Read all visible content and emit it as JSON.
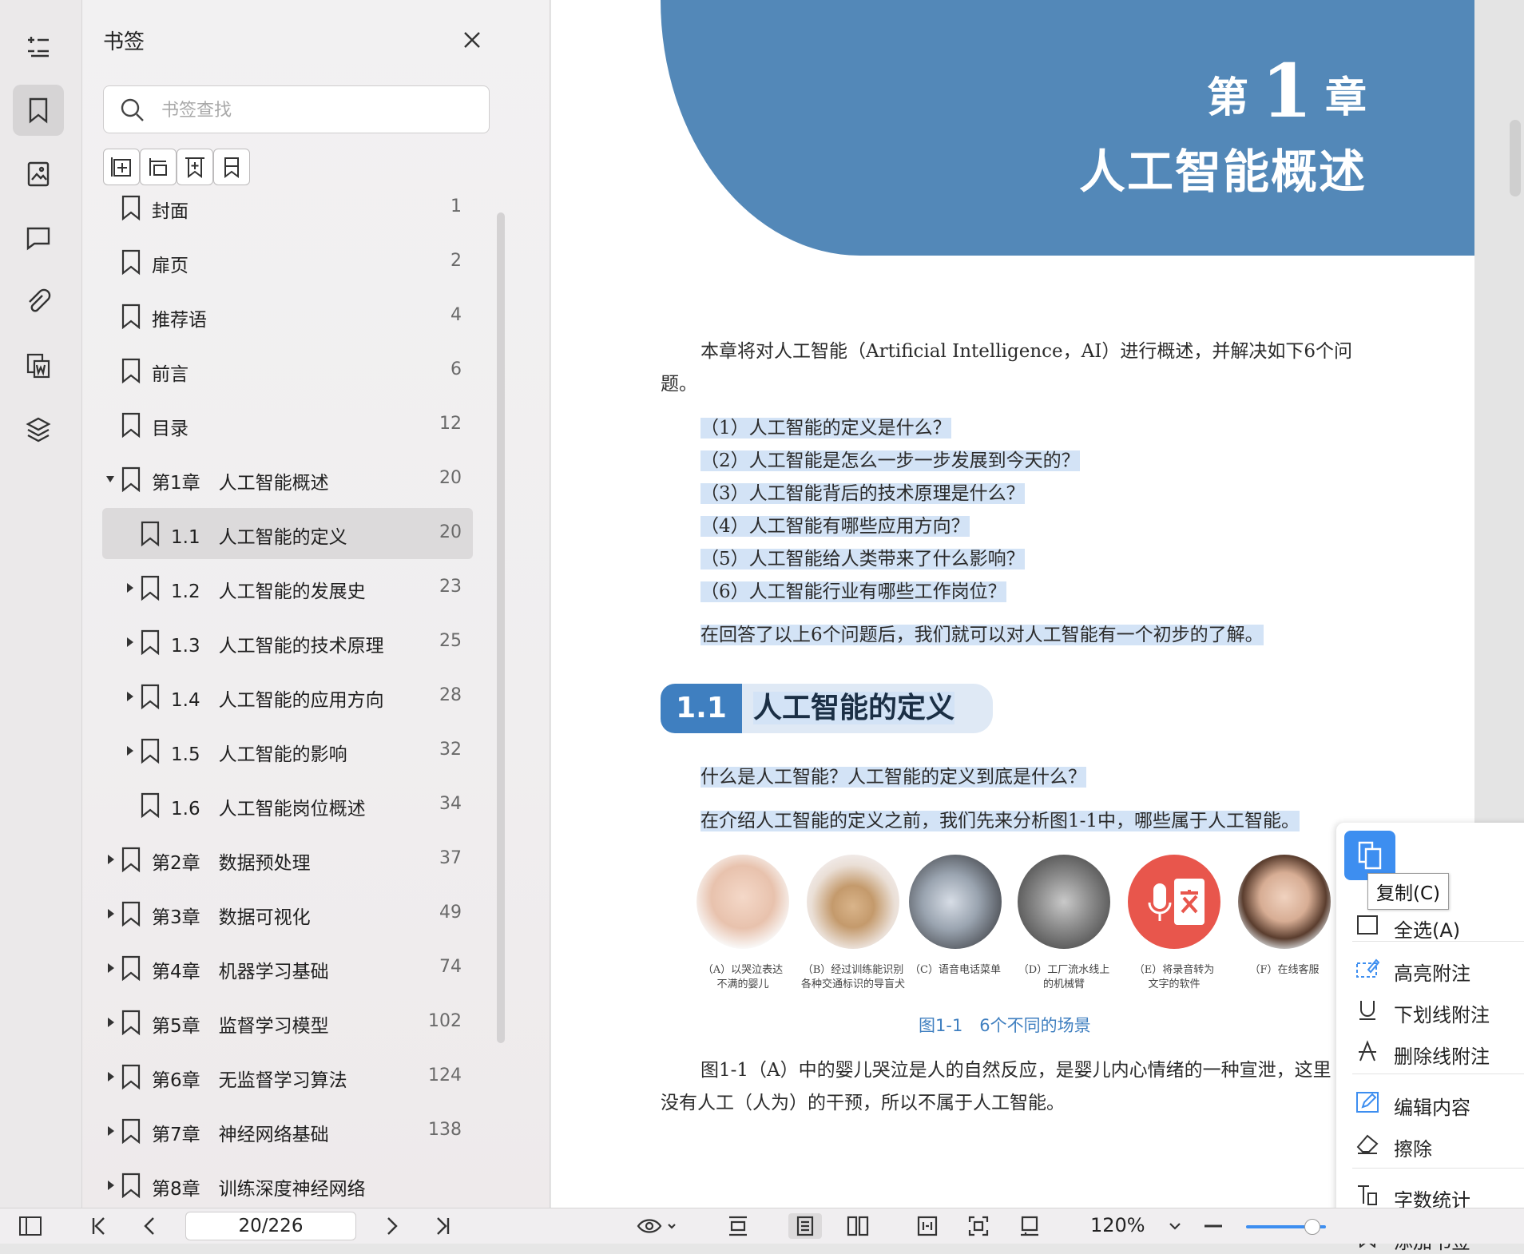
{
  "rail": {
    "items": [
      {
        "name": "outline-icon"
      },
      {
        "name": "bookmark-icon"
      },
      {
        "name": "thumbnail-icon"
      },
      {
        "name": "comment-icon"
      },
      {
        "name": "attachment-icon"
      },
      {
        "name": "word-convert-icon"
      },
      {
        "name": "layers-icon"
      }
    ]
  },
  "panel": {
    "title": "书签",
    "search_placeholder": "书签查找",
    "tools": [
      "add-bookmark-icon",
      "add-child-bookmark-icon",
      "insert-bookmark-icon",
      "bookmark-toggle-icon"
    ],
    "bookmarks": [
      {
        "label": "封面",
        "page": "1",
        "level": 0,
        "caret": false
      },
      {
        "label": "扉页",
        "page": "2",
        "level": 0,
        "caret": false
      },
      {
        "label": "推荐语",
        "page": "4",
        "level": 0,
        "caret": false
      },
      {
        "label": "前言",
        "page": "6",
        "level": 0,
        "caret": false
      },
      {
        "label": "目录",
        "page": "12",
        "level": 0,
        "caret": false
      },
      {
        "label": "第1章　人工智能概述",
        "page": "20",
        "level": 0,
        "caret": "down"
      },
      {
        "label": "1.1　人工智能的定义",
        "page": "20",
        "level": 1,
        "caret": false,
        "selected": true
      },
      {
        "label": "1.2　人工智能的发展史",
        "page": "23",
        "level": 1,
        "caret": "right"
      },
      {
        "label": "1.3　人工智能的技术原理",
        "page": "25",
        "level": 1,
        "caret": "right"
      },
      {
        "label": "1.4　人工智能的应用方向",
        "page": "28",
        "level": 1,
        "caret": "right"
      },
      {
        "label": "1.5　人工智能的影响",
        "page": "32",
        "level": 1,
        "caret": "right"
      },
      {
        "label": "1.6　人工智能岗位概述",
        "page": "34",
        "level": 1,
        "caret": false
      },
      {
        "label": "第2章　数据预处理",
        "page": "37",
        "level": 0,
        "caret": "right"
      },
      {
        "label": "第3章　数据可视化",
        "page": "49",
        "level": 0,
        "caret": "right"
      },
      {
        "label": "第4章　机器学习基础",
        "page": "74",
        "level": 0,
        "caret": "right"
      },
      {
        "label": "第5章　监督学习模型",
        "page": "102",
        "level": 0,
        "caret": "right"
      },
      {
        "label": "第6章　无监督学习算法",
        "page": "124",
        "level": 0,
        "caret": "right"
      },
      {
        "label": "第7章　神经网络基础",
        "page": "138",
        "level": 0,
        "caret": "right"
      },
      {
        "label": "第8章　训练深度神经网络",
        "page": "",
        "level": 0,
        "caret": "right"
      }
    ]
  },
  "document": {
    "chapter_prefix": "第",
    "chapter_number": "1",
    "chapter_suffix": "章",
    "chapter_title": "人工智能概述",
    "intro": "本章将对人工智能（Artificial Intelligence，AI）进行概述，并解决如下6个问题。",
    "questions": [
      "（1）人工智能的定义是什么？",
      "（2）人工智能是怎么一步一步发展到今天的？",
      "（3）人工智能背后的技术原理是什么？",
      "（4）人工智能有哪些应用方向？",
      "（5）人工智能给人类带来了什么影响？",
      "（6）人工智能行业有哪些工作岗位？"
    ],
    "summary": "在回答了以上6个问题后，我们就可以对人工智能有一个初步的了解。",
    "section_number": "1.1",
    "section_title": "人工智能的定义",
    "para1": "什么是人工智能？人工智能的定义到底是什么？",
    "para2": "在介绍人工智能的定义之前，我们先来分析图1-1中，哪些属于人工智能。",
    "figure": {
      "captions": [
        "（A）以哭泣表达\n不满的婴儿",
        "（B）经过训练能识别\n各种交通标识的导盲犬",
        "（C）语音电话菜单",
        "（D）工厂流水线上\n的机械臂",
        "（E）将录音转为\n文字的软件",
        "（F）在线客服"
      ],
      "title": "图1-1　6个不同的场景"
    },
    "para3": "图1-1（A）中的婴儿哭泣是人的自然反应，是婴儿内心情绪的一种宣泄，这里没有人工（人为）的干预，所以不属于人工智能。"
  },
  "context_menu": {
    "copy_tooltip": "复制(C)",
    "items": [
      {
        "label": "全选(A)",
        "icon": "select-all-icon"
      },
      {
        "label": "高亮附注",
        "icon": "highlight-icon"
      },
      {
        "label": "下划线附注",
        "icon": "underline-icon"
      },
      {
        "label": "删除线附注",
        "icon": "strikethrough-icon"
      },
      {
        "label": "编辑内容",
        "icon": "edit-icon"
      },
      {
        "label": "擦除",
        "icon": "eraser-icon"
      },
      {
        "label": "字数统计",
        "icon": "word-count-icon"
      },
      {
        "label": "添加书签",
        "icon": "add-bookmark-icon"
      }
    ]
  },
  "statusbar": {
    "page_indicator": "20/226",
    "zoom": "120%",
    "zoom_level": 0.82
  },
  "colors": {
    "accent": "#3d8ef0",
    "chapter_band": "#5388b8",
    "section_blue": "#3f7fc0",
    "highlight": "#d3e3f6"
  }
}
